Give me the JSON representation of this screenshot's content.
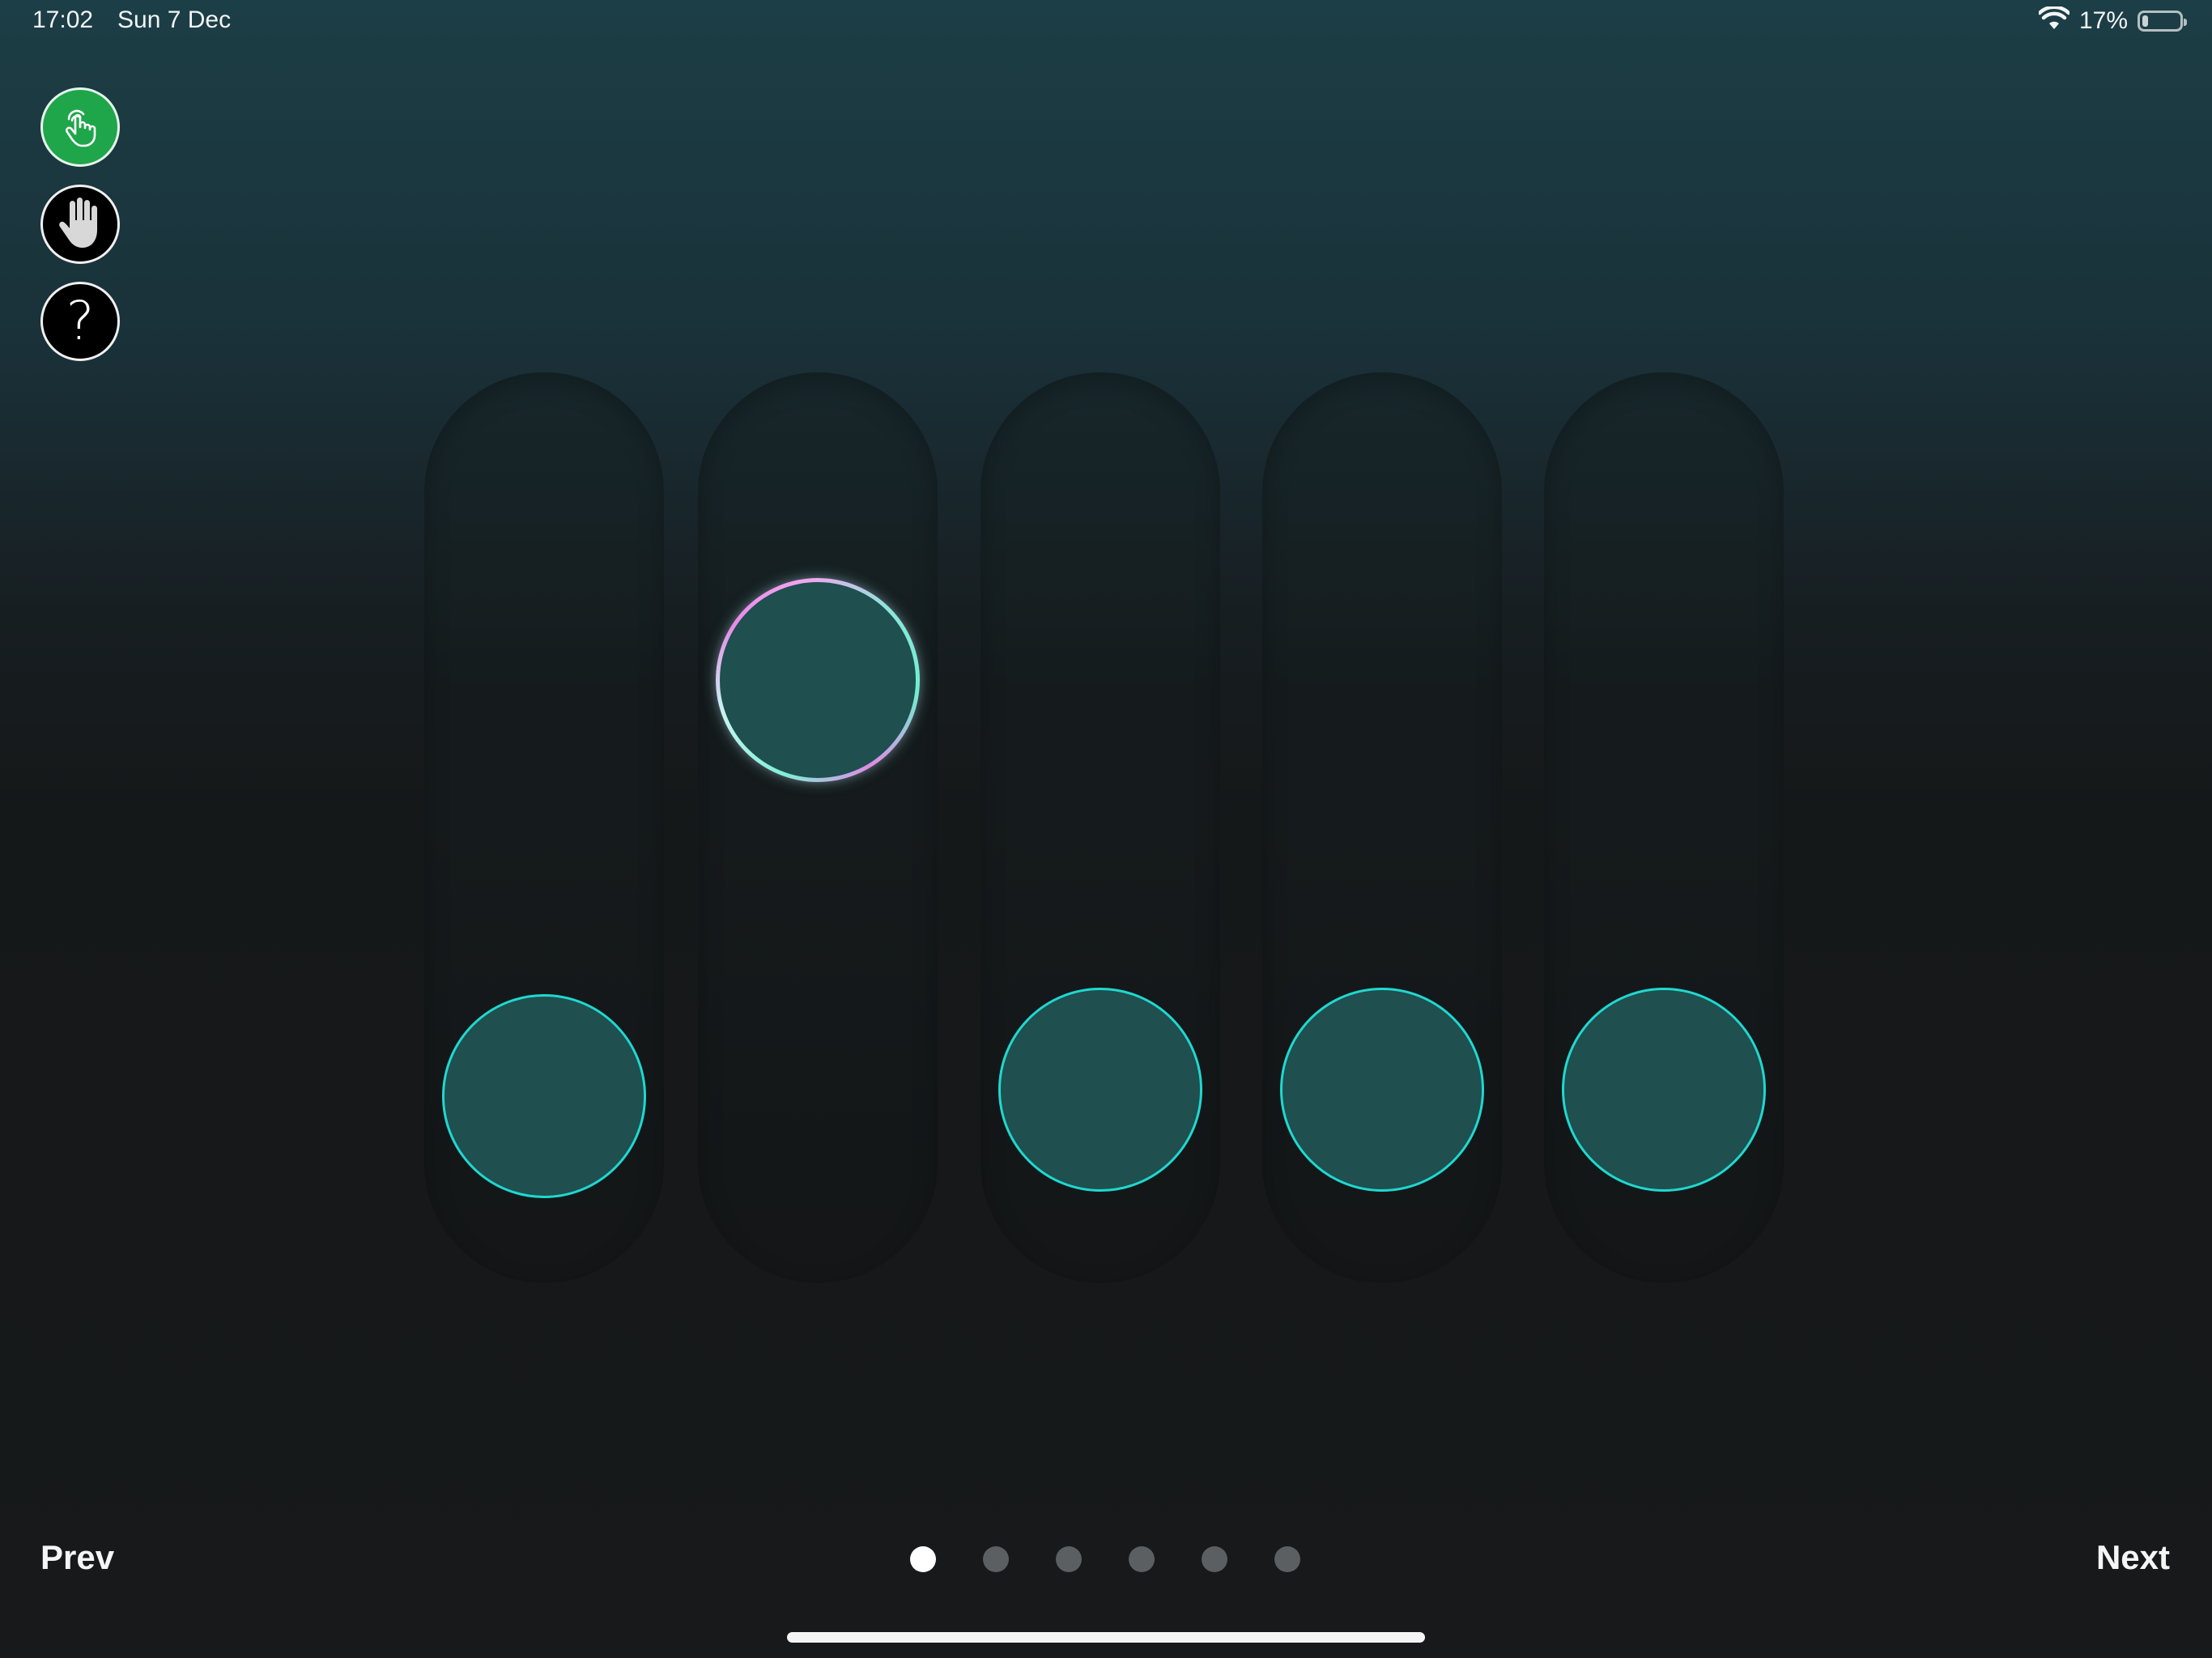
{
  "status_bar": {
    "time": "17:02",
    "date": "Sun 7 Dec",
    "battery_percent": "17%",
    "battery_level": 0.17,
    "wifi_icon": "wifi-icon",
    "battery_icon": "battery-icon"
  },
  "tools": {
    "touch_icon": "touch-hand-icon",
    "hand_icon": "open-hand-icon",
    "help_label": "?"
  },
  "sliders": {
    "count": 5,
    "active_index": 1,
    "positions": [
      0.1,
      0.72,
      0.11,
      0.11,
      0.11
    ]
  },
  "colors": {
    "accent": "#1fd8d0",
    "knob_fill": "#1f4f4f",
    "touch_button": "#1fa64a"
  },
  "pager": {
    "total": 6,
    "current": 0
  },
  "nav": {
    "prev_label": "Prev",
    "next_label": "Next"
  }
}
